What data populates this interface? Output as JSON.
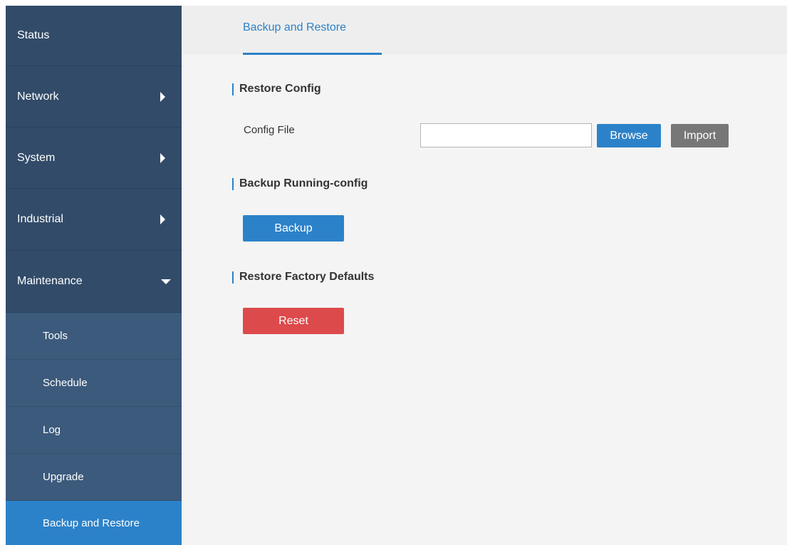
{
  "sidebar": {
    "items": [
      {
        "label": "Status"
      },
      {
        "label": "Network",
        "arrow": "chevron-right"
      },
      {
        "label": "System",
        "arrow": "chevron-right"
      },
      {
        "label": "Industrial",
        "arrow": "chevron-right"
      },
      {
        "label": "Maintenance",
        "arrow": "chevron-down"
      }
    ],
    "sub_items": [
      {
        "label": "Tools"
      },
      {
        "label": "Schedule"
      },
      {
        "label": "Log"
      },
      {
        "label": "Upgrade"
      },
      {
        "label": "Backup and Restore",
        "active": true
      }
    ]
  },
  "tabs": [
    {
      "label": "Backup and Restore",
      "active": true
    }
  ],
  "restore_config": {
    "title": "Restore Config",
    "field_label": "Config File",
    "file_value": "",
    "browse_label": "Browse",
    "import_label": "Import"
  },
  "backup_running": {
    "title": "Backup Running-config",
    "button_label": "Backup"
  },
  "factory_defaults": {
    "title": "Restore Factory Defaults",
    "button_label": "Reset"
  },
  "colors": {
    "sidebar_bg": "#324b69",
    "submenu_bg": "#3c5a7c",
    "accent_blue": "#2c82c9",
    "danger_red": "#dd4a4b",
    "import_gray": "#777777"
  }
}
